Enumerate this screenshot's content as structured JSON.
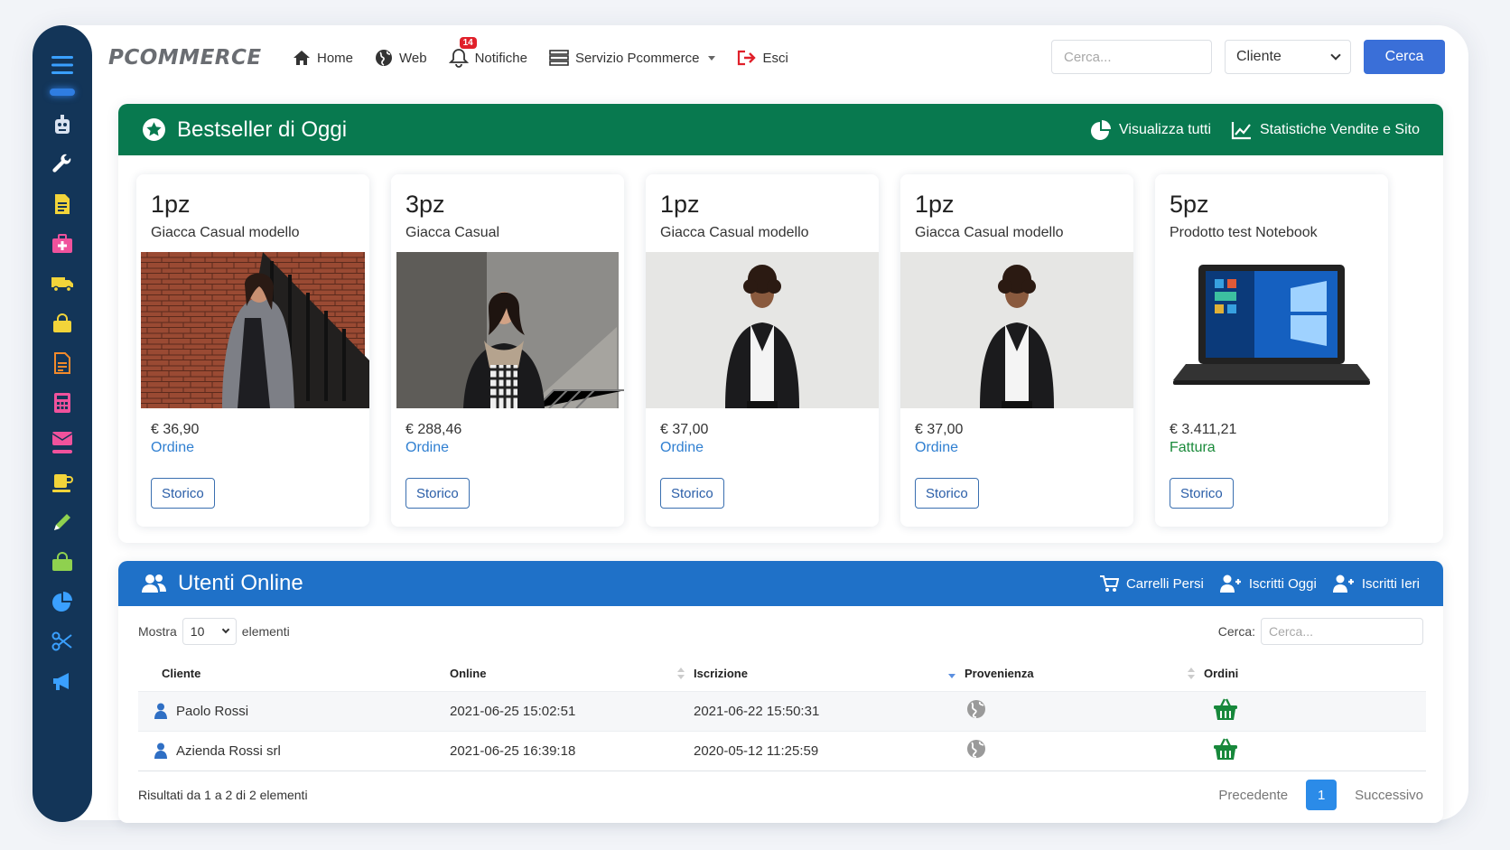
{
  "app": {
    "logo": "PCOMMERCE"
  },
  "nav": {
    "home": "Home",
    "web": "Web",
    "notifications": "Notifiche",
    "notifications_count": "14",
    "service": "Servizio Pcommerce",
    "logout": "Esci"
  },
  "topsearch": {
    "placeholder": "Cerca...",
    "select_value": "Cliente",
    "button": "Cerca"
  },
  "sidebar": {
    "icons": [
      "menu-icon",
      "robot-icon",
      "wrench-icon",
      "document-icon",
      "medkit-icon",
      "truck-icon",
      "shopping-bag-icon",
      "file-text-icon",
      "calculator-icon",
      "envelope-icon",
      "mug-icon",
      "pencil-icon",
      "bag-icon",
      "pie-chart-icon",
      "scissors-icon",
      "megaphone-icon"
    ]
  },
  "bestsellers": {
    "title": "Bestseller di Oggi",
    "actions": {
      "view_all": "Visualizza tutti",
      "stats": "Statistiche Vendite e Sito"
    },
    "cards": [
      {
        "qty": "1pz",
        "name": "Giacca Casual modello",
        "price": "€ 36,90",
        "kind": "Ordine",
        "button": "Storico"
      },
      {
        "qty": "3pz",
        "name": "Giacca Casual",
        "price": "€ 288,46",
        "kind": "Ordine",
        "button": "Storico"
      },
      {
        "qty": "1pz",
        "name": "Giacca Casual modello",
        "price": "€ 37,00",
        "kind": "Ordine",
        "button": "Storico"
      },
      {
        "qty": "1pz",
        "name": "Giacca Casual modello",
        "price": "€ 37,00",
        "kind": "Ordine",
        "button": "Storico"
      },
      {
        "qty": "5pz",
        "name": "Prodotto test Notebook",
        "price": "€ 3.411,21",
        "kind": "Fattura",
        "button": "Storico"
      }
    ]
  },
  "online": {
    "title": "Utenti Online",
    "actions": {
      "carts": "Carrelli Persi",
      "today": "Iscritti Oggi",
      "yesterday": "Iscritti Ieri"
    },
    "show_label": "Mostra",
    "show_value": "10",
    "elements_label": "elementi",
    "search_label": "Cerca:",
    "search_placeholder": "Cerca...",
    "columns": [
      "Cliente",
      "Online",
      "Iscrizione",
      "Provenienza",
      "Ordini"
    ],
    "rows": [
      {
        "cliente": "Paolo Rossi",
        "online": "2021-06-25 15:02:51",
        "iscrizione": "2021-06-22 15:50:31"
      },
      {
        "cliente": "Azienda Rossi srl",
        "online": "2021-06-25 16:39:18",
        "iscrizione": "2020-05-12 11:25:59"
      }
    ],
    "results": "Risultati da 1 a 2 di 2 elementi",
    "pager": {
      "prev": "Precedente",
      "page": "1",
      "next": "Successivo"
    }
  }
}
